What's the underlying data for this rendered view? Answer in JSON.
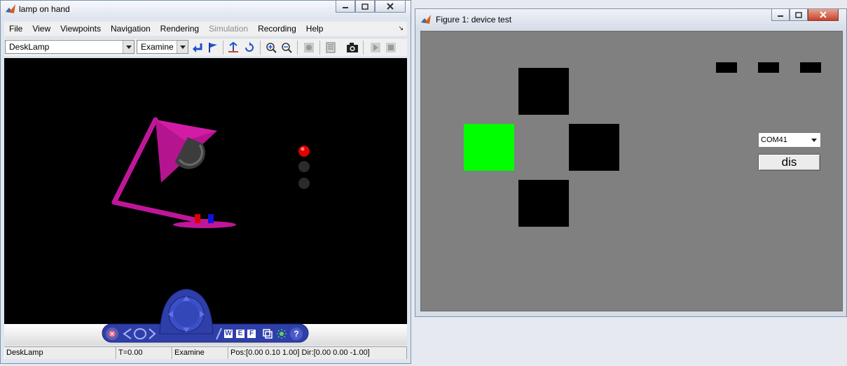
{
  "vr_window": {
    "title": "lamp on hand",
    "menu": [
      "File",
      "View",
      "Viewpoints",
      "Navigation",
      "Rendering",
      "Simulation",
      "Recording",
      "Help"
    ],
    "disabled_menu": "Simulation",
    "viewpoint_select": "DeskLamp",
    "nav_mode_select": "Examine",
    "nav_panel_letters": [
      "W",
      "E",
      "F"
    ],
    "nav_panel_help": "?",
    "status": {
      "viewpoint": "DeskLamp",
      "time": "T=0.00",
      "mode": "Examine",
      "pos_dir": "Pos:[0.00 0.10 1.00] Dir:[0.00 0.00 -1.00]"
    },
    "colors": {
      "lamp": "#c0169a",
      "led_on": "#e00000",
      "viewport_bg": "#000000"
    }
  },
  "figure_window": {
    "title": "Figure 1: device test",
    "port_select": "COM41",
    "button_label": "dis",
    "colors": {
      "canvas_bg": "#808080",
      "active_block": "#00ff00",
      "block": "#000000"
    }
  }
}
